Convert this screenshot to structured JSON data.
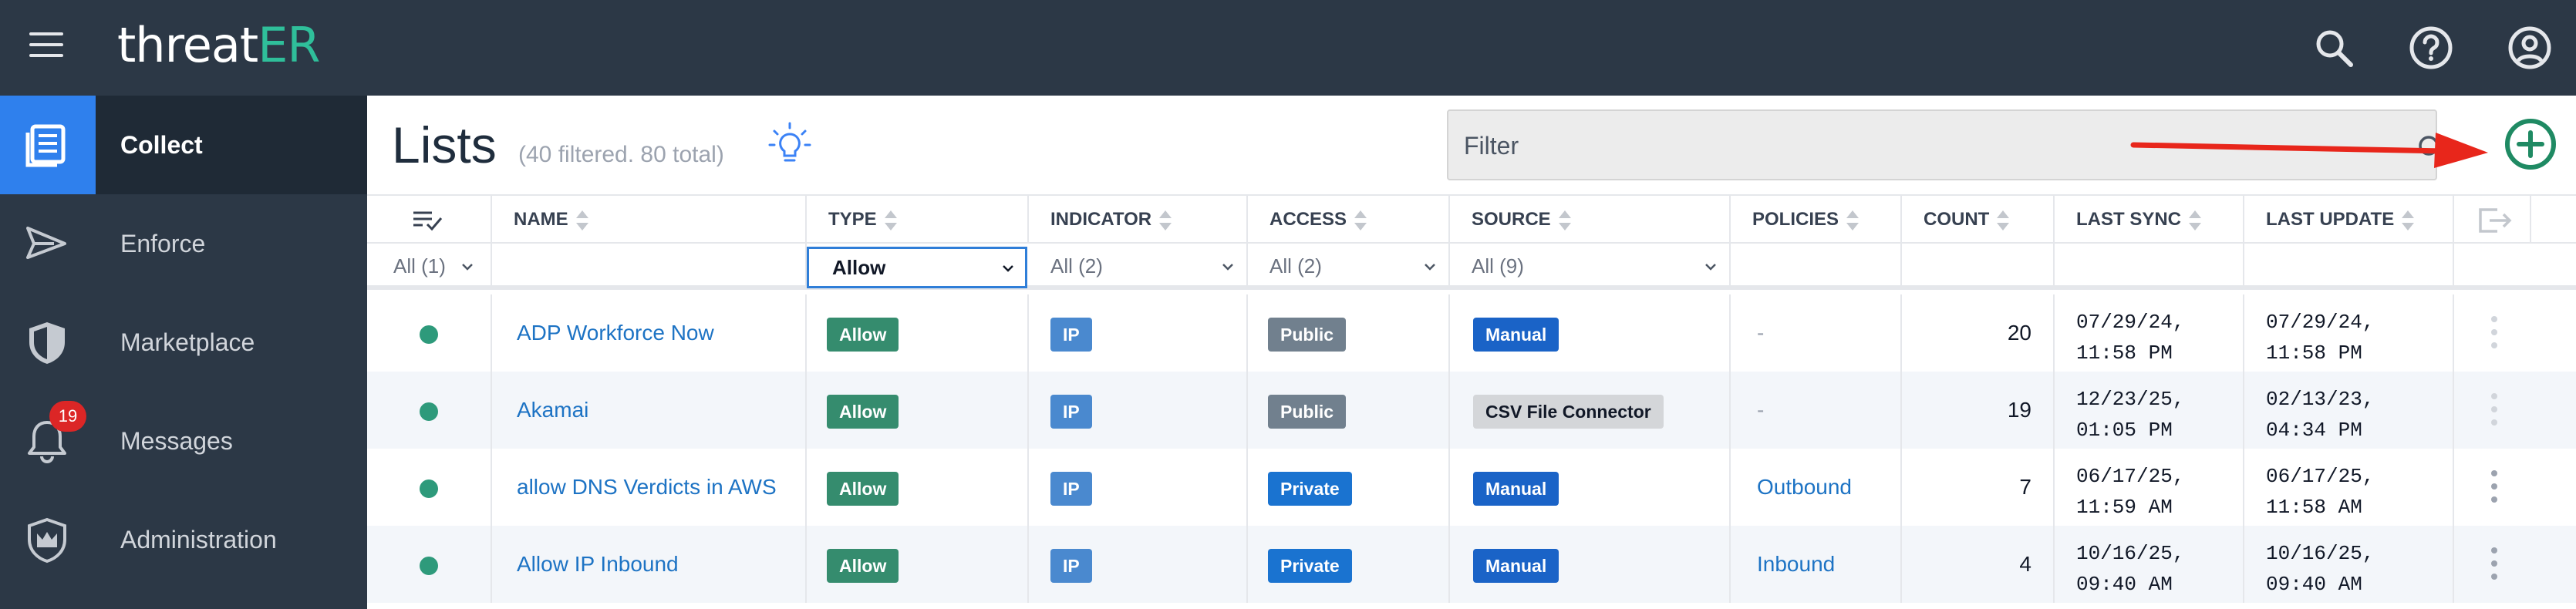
{
  "app": {
    "logo_main": "threat",
    "logo_accent": "ER",
    "menu_icon": "hamburger-icon",
    "top_icons": [
      "search-icon",
      "help-icon",
      "user-icon"
    ]
  },
  "sidebar": {
    "items": [
      {
        "label": "Collect",
        "icon": "document-list-icon",
        "active": true
      },
      {
        "label": "Enforce",
        "icon": "send-icon"
      },
      {
        "label": "Marketplace",
        "icon": "shield-icon"
      },
      {
        "label": "Messages",
        "icon": "bell-icon",
        "badge": "19"
      },
      {
        "label": "Administration",
        "icon": "crown-shield-icon"
      }
    ]
  },
  "header": {
    "title": "Lists",
    "subtitle": "(40 filtered. 80 total)",
    "filter_placeholder": "Filter"
  },
  "table": {
    "columns": [
      "NAME",
      "TYPE",
      "INDICATOR",
      "ACCESS",
      "SOURCE",
      "POLICIES",
      "COUNT",
      "LAST SYNC",
      "LAST UPDATE"
    ],
    "filters": {
      "status": "All (1)",
      "type": "Allow",
      "indicator": "All (2)",
      "access": "All (2)",
      "source": "All (9)"
    },
    "rows": [
      {
        "name": "ADP Workforce Now",
        "type": "Allow",
        "indicator": "IP",
        "access": "Public",
        "source": "Manual",
        "policies": "-",
        "count": "20",
        "sync_date": "07/29/24,",
        "sync_time": "11:58 PM",
        "update_date": "07/29/24,",
        "update_time": "11:58 PM"
      },
      {
        "name": "Akamai",
        "type": "Allow",
        "indicator": "IP",
        "access": "Public",
        "source": "CSV File Connector",
        "policies": "-",
        "count": "19",
        "sync_date": "12/23/25,",
        "sync_time": "01:05 PM",
        "update_date": "02/13/23,",
        "update_time": "04:34 PM"
      },
      {
        "name": "allow DNS Verdicts in AWS",
        "type": "Allow",
        "indicator": "IP",
        "access": "Private",
        "source": "Manual",
        "policies": "Outbound",
        "count": "7",
        "sync_date": "06/17/25,",
        "sync_time": "11:59 AM",
        "update_date": "06/17/25,",
        "update_time": "11:58 AM"
      },
      {
        "name": "Allow IP Inbound",
        "type": "Allow",
        "indicator": "IP",
        "access": "Private",
        "source": "Manual",
        "policies": "Inbound",
        "count": "4",
        "sync_date": "10/16/25,",
        "sync_time": "09:40 AM",
        "update_date": "10/16/25,",
        "update_time": "09:40 AM"
      }
    ]
  },
  "colors": {
    "topbar": "#2c3846",
    "active_accent": "#2f80ed",
    "status_dot": "#2e9a7b",
    "allow_tag": "#358c6e",
    "add_button": "#1f8a63",
    "arrow": "#e8261b"
  }
}
